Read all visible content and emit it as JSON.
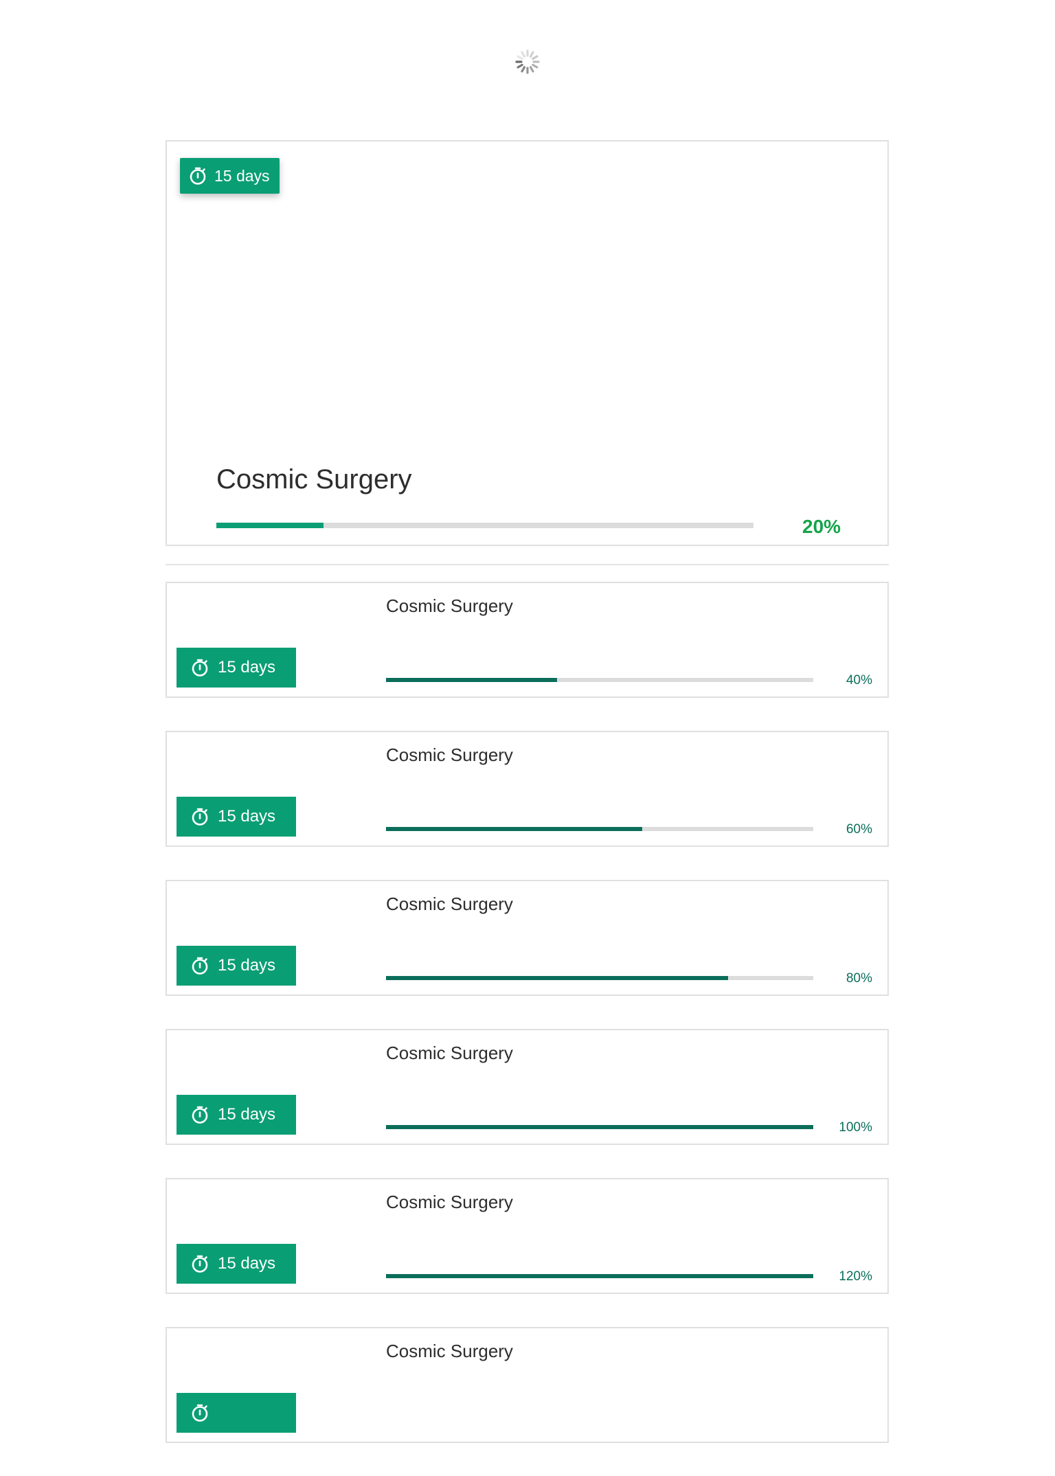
{
  "colors": {
    "accent": "#0a9e74",
    "progress_dark": "#0b6e5b",
    "percent_green": "#14a44a",
    "track": "#dcdcdc",
    "border": "#e0e0e0"
  },
  "loader": {
    "icon": "loading-spinner-icon"
  },
  "featured": {
    "badge_icon": "stopwatch-icon",
    "badge_label": "15 days",
    "title": "Cosmic Surgery",
    "progress": 20,
    "percent_label": "20%"
  },
  "items": [
    {
      "badge_icon": "stopwatch-icon",
      "badge_label": "15 days",
      "title": "Cosmic Surgery",
      "progress": 40,
      "percent_label": "40%"
    },
    {
      "badge_icon": "stopwatch-icon",
      "badge_label": "15 days",
      "title": "Cosmic Surgery",
      "progress": 60,
      "percent_label": "60%"
    },
    {
      "badge_icon": "stopwatch-icon",
      "badge_label": "15 days",
      "title": "Cosmic Surgery",
      "progress": 80,
      "percent_label": "80%"
    },
    {
      "badge_icon": "stopwatch-icon",
      "badge_label": "15 days",
      "title": "Cosmic Surgery",
      "progress": 100,
      "percent_label": "100%"
    },
    {
      "badge_icon": "stopwatch-icon",
      "badge_label": "15 days",
      "title": "Cosmic Surgery",
      "progress": 120,
      "percent_label": "120%"
    },
    {
      "badge_icon": "stopwatch-icon",
      "badge_label": "",
      "title": "Cosmic Surgery",
      "progress": null,
      "percent_label": ""
    }
  ]
}
